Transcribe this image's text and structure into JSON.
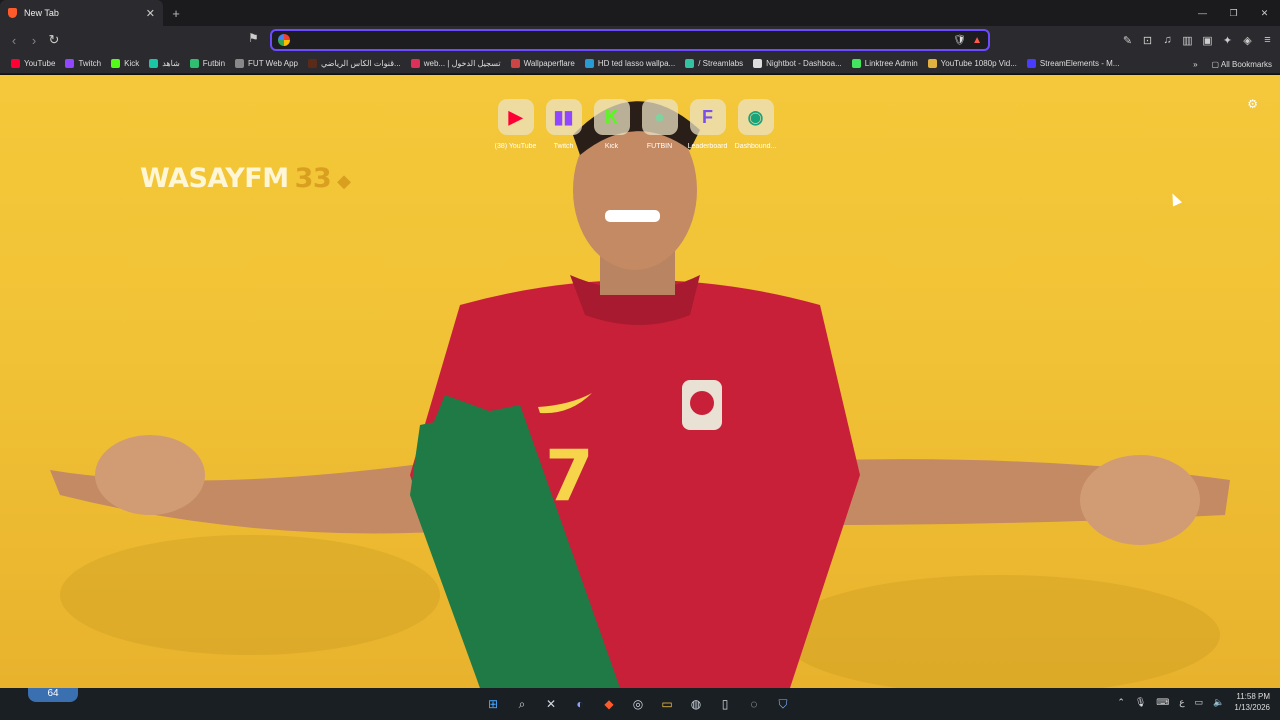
{
  "tab": {
    "title": "New Tab",
    "close": "✕",
    "new": "+"
  },
  "window": {
    "minimize": "—",
    "restore": "❐",
    "close": "✕"
  },
  "omnibox": {
    "value": "",
    "placeholder": ""
  },
  "bookmarks": [
    {
      "label": "YouTube",
      "color": "#ff0033"
    },
    {
      "label": "Twitch",
      "color": "#9146ff"
    },
    {
      "label": "Kick",
      "color": "#53fc18"
    },
    {
      "label": "شاهد",
      "color": "#19c6a6"
    },
    {
      "label": "Futbin",
      "color": "#2fbf71"
    },
    {
      "label": "FUT Web App",
      "color": "#888888"
    },
    {
      "label": "قنوات الكأس الرياضي...",
      "color": "#5a2a1a"
    },
    {
      "label": "web... | تسجيل الدخول",
      "color": "#e0305a"
    },
    {
      "label": "Wallpaperflare",
      "color": "#cc4444"
    },
    {
      "label": "HD ted lasso wallpa...",
      "color": "#2a9ad4"
    },
    {
      "label": "/ Streamlabs",
      "color": "#31c3a2"
    },
    {
      "label": "Nightbot - Dashboa...",
      "color": "#dddddd"
    },
    {
      "label": "Linktree Admin",
      "color": "#43e55e"
    },
    {
      "label": "YouTube 1080p Vid...",
      "color": "#e0b040"
    },
    {
      "label": "StreamElements - M...",
      "color": "#4a3cff"
    }
  ],
  "bookmarks_more": "»",
  "all_bookmarks": "All Bookmarks",
  "brand": {
    "name": "WASAYFM",
    "number": "33",
    "symbol": "◆"
  },
  "shortcuts": [
    {
      "label": "(38) YouTube",
      "glyph": "▶",
      "color": "#ff0033"
    },
    {
      "label": "Twitch",
      "glyph": "▮▮",
      "color": "#9146ff"
    },
    {
      "label": "Kick",
      "glyph": "K",
      "color": "#53fc18"
    },
    {
      "label": "FUTBIN",
      "glyph": "●",
      "color": "#7fd3a0"
    },
    {
      "label": "Leaderboard",
      "glyph": "F",
      "color": "#7a4ff0"
    },
    {
      "label": "Dashbound...",
      "glyph": "◉",
      "color": "#18a37b"
    }
  ],
  "taskbar": {
    "weather_temp": "64",
    "time": "11:58 PM",
    "date": "1/13/2026",
    "lang": "ع"
  }
}
